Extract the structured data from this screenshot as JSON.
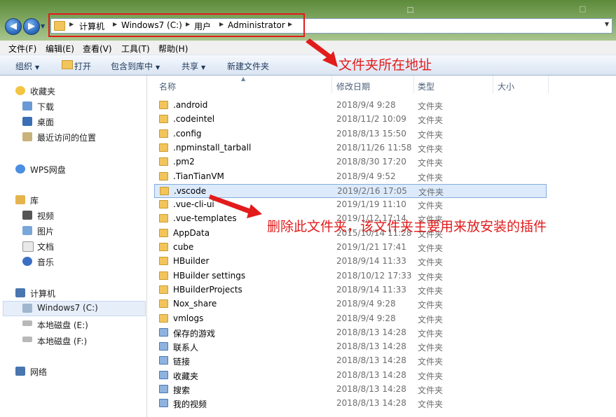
{
  "address": {
    "crumbs": [
      "计算机",
      "Windows7 (C:)",
      "用户",
      "Administrator"
    ]
  },
  "background_text": [
    "口",
    "□"
  ],
  "menu": [
    "文件(F)",
    "编辑(E)",
    "查看(V)",
    "工具(T)",
    "帮助(H)"
  ],
  "toolbar": {
    "organize": "组织",
    "open": "打开",
    "include_library": "包含到库中",
    "share": "共享",
    "new_folder": "新建文件夹"
  },
  "sidebar": {
    "favorites": "收藏夹",
    "downloads": "下载",
    "desktop": "桌面",
    "recent": "最近访问的位置",
    "wps": "WPS网盘",
    "libraries": "库",
    "videos": "视频",
    "pictures": "图片",
    "documents": "文档",
    "music": "音乐",
    "computer": "计算机",
    "drive_c": "Windows7 (C:)",
    "drive_e": "本地磁盘 (E:)",
    "drive_f": "本地磁盘 (F:)",
    "network": "网络"
  },
  "columns": {
    "name": "名称",
    "modified": "修改日期",
    "type": "类型",
    "size": "大小"
  },
  "files": [
    {
      "name": ".android",
      "date": "2018/9/4 9:28",
      "type": "文件夹"
    },
    {
      "name": ".codeintel",
      "date": "2018/11/2 10:09",
      "type": "文件夹"
    },
    {
      "name": ".config",
      "date": "2018/8/13 15:50",
      "type": "文件夹"
    },
    {
      "name": ".npminstall_tarball",
      "date": "2018/11/26 11:58",
      "type": "文件夹"
    },
    {
      "name": ".pm2",
      "date": "2018/8/30 17:20",
      "type": "文件夹"
    },
    {
      "name": ".TianTianVM",
      "date": "2018/9/4 9:52",
      "type": "文件夹"
    },
    {
      "name": ".vscode",
      "date": "2019/2/16 17:05",
      "type": "文件夹"
    },
    {
      "name": ".vue-cli-ui",
      "date": "2019/1/19 11:10",
      "type": "文件夹"
    },
    {
      "name": ".vue-templates",
      "date": "2019/1/12 17:14",
      "type": "文件夹"
    },
    {
      "name": "AppData",
      "date": "2015/10/14 11:28",
      "type": "文件夹"
    },
    {
      "name": "cube",
      "date": "2019/1/21 17:41",
      "type": "文件夹"
    },
    {
      "name": "HBuilder",
      "date": "2018/9/14 11:33",
      "type": "文件夹"
    },
    {
      "name": "HBuilder settings",
      "date": "2018/10/12 17:33",
      "type": "文件夹"
    },
    {
      "name": "HBuilderProjects",
      "date": "2018/9/14 11:33",
      "type": "文件夹"
    },
    {
      "name": "Nox_share",
      "date": "2018/9/4 9:28",
      "type": "文件夹"
    },
    {
      "name": "vmlogs",
      "date": "2018/9/4 9:28",
      "type": "文件夹"
    },
    {
      "name": "保存的游戏",
      "date": "2018/8/13 14:28",
      "type": "文件夹"
    },
    {
      "name": "联系人",
      "date": "2018/8/13 14:28",
      "type": "文件夹"
    },
    {
      "name": "链接",
      "date": "2018/8/13 14:28",
      "type": "文件夹"
    },
    {
      "name": "收藏夹",
      "date": "2018/8/13 14:28",
      "type": "文件夹"
    },
    {
      "name": "搜索",
      "date": "2018/8/13 14:28",
      "type": "文件夹"
    },
    {
      "name": "我的视频",
      "date": "2018/8/13 14:28",
      "type": "文件夹"
    }
  ],
  "annotations": {
    "address_note": "文件夹所在地址",
    "delete_note": "删除此文件夹，该文件夹主要用来放安装的插件"
  },
  "colors": {
    "annotation": "#e21b1b",
    "selection": "#dceafc"
  }
}
